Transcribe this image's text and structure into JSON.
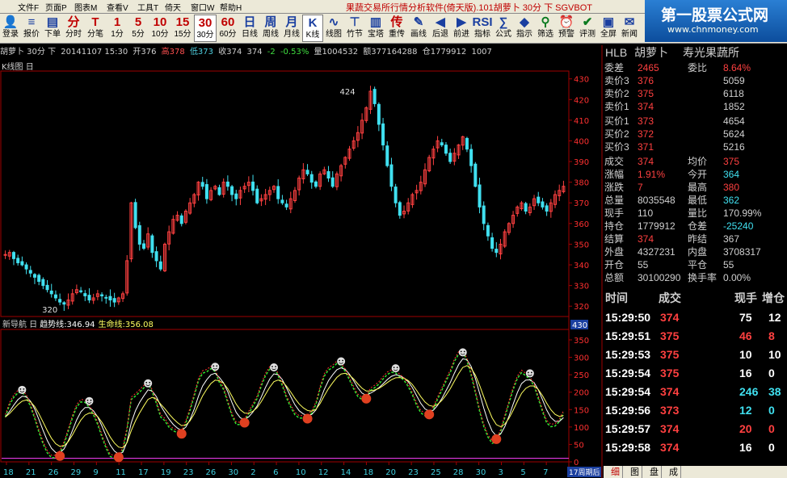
{
  "window": {
    "menus": [
      "文件F",
      "页面P",
      "图表M",
      "查看V",
      "工具T",
      "倚天",
      "窗口W",
      "帮助H"
    ],
    "title": "果蔬交易所行情分析软件(倚天版).101胡萝卜 30分 下 SGVBOT"
  },
  "brand": {
    "name": "第一股票公式网",
    "url": "www.chnmoney.com"
  },
  "toolbar": [
    {
      "icon": "👤",
      "label": "登录",
      "name": "login",
      "color": "blue"
    },
    {
      "icon": "≡",
      "label": "报价",
      "name": "quote",
      "color": "blue"
    },
    {
      "icon": "▤",
      "label": "下单",
      "name": "order",
      "color": "blue"
    },
    {
      "icon": "分",
      "label": "分时",
      "name": "intraday",
      "color": "red"
    },
    {
      "icon": "T",
      "label": "分笔",
      "name": "tick",
      "color": "red"
    },
    {
      "icon": "1",
      "label": "1分",
      "name": "1min",
      "color": "red"
    },
    {
      "icon": "5",
      "label": "5分",
      "name": "5min",
      "color": "red"
    },
    {
      "icon": "10",
      "label": "10分",
      "name": "10min",
      "color": "red"
    },
    {
      "icon": "15",
      "label": "15分",
      "name": "15min",
      "color": "red"
    },
    {
      "icon": "30",
      "label": "30分",
      "name": "30min",
      "color": "red",
      "selected": true
    },
    {
      "icon": "60",
      "label": "60分",
      "name": "60min",
      "color": "red"
    },
    {
      "icon": "日",
      "label": "日线",
      "name": "daily",
      "color": "blue"
    },
    {
      "icon": "周",
      "label": "周线",
      "name": "weekly",
      "color": "blue"
    },
    {
      "icon": "月",
      "label": "月线",
      "name": "monthly",
      "color": "blue"
    },
    {
      "icon": "K",
      "label": "K线",
      "name": "kline",
      "color": "blue",
      "selected": true
    },
    {
      "icon": "∿",
      "label": "线图",
      "name": "linechart",
      "color": "blue"
    },
    {
      "icon": "⊤",
      "label": "竹节",
      "name": "bamboo",
      "color": "blue"
    },
    {
      "icon": "▥",
      "label": "宝塔",
      "name": "tower",
      "color": "blue"
    },
    {
      "icon": "传",
      "label": "重传",
      "name": "resend",
      "color": "red"
    },
    {
      "icon": "✎",
      "label": "画线",
      "name": "draw",
      "color": "blue"
    },
    {
      "icon": "◀",
      "label": "后退",
      "name": "back",
      "color": "blue"
    },
    {
      "icon": "▶",
      "label": "前进",
      "name": "forward",
      "color": "blue"
    },
    {
      "icon": "RSI",
      "label": "指标",
      "name": "indicator",
      "color": "blue"
    },
    {
      "icon": "∑",
      "label": "公式",
      "name": "formula",
      "color": "blue"
    },
    {
      "icon": "◆",
      "label": "指示",
      "name": "hint",
      "color": "blue"
    },
    {
      "icon": "⚲",
      "label": "筛选",
      "name": "filter",
      "color": "green"
    },
    {
      "icon": "⏰",
      "label": "预警",
      "name": "alert",
      "color": "red"
    },
    {
      "icon": "✔",
      "label": "评测",
      "name": "evaluate",
      "color": "green"
    },
    {
      "icon": "▣",
      "label": "全屏",
      "name": "fullscreen",
      "color": "blue"
    },
    {
      "icon": "✉",
      "label": "新闻",
      "name": "news",
      "color": "blue"
    }
  ],
  "infobar": {
    "symbol": "胡萝卜 30分 下",
    "date": "20141107 15:30",
    "open": "开376",
    "high": "高378",
    "low": "低373",
    "close": "收374",
    "last": "374",
    "change": "-2",
    "pct": "-0.53%",
    "volume": "量1004532",
    "amount": "额377164288",
    "position": "仓1779912",
    "extra": "1007"
  },
  "kline_label": "K线图 日",
  "chart_data": [
    {
      "type": "candlestick",
      "title": "",
      "ylim": [
        315,
        433
      ],
      "yticks": [
        320,
        330,
        340,
        350,
        360,
        370,
        380,
        390,
        400,
        410,
        420,
        430
      ],
      "annotations": [
        {
          "text": "424",
          "value": 424
        },
        {
          "text": "320",
          "value": 320
        }
      ],
      "series": [
        {
          "values": [
            345,
            346,
            343,
            341,
            340,
            338,
            336,
            334,
            332,
            330,
            328,
            326,
            324,
            322,
            321,
            323,
            326,
            328,
            327,
            325,
            323,
            324,
            326,
            325,
            324,
            323,
            322,
            324,
            326,
            342,
            370,
            358,
            350,
            348,
            355,
            346,
            342,
            338,
            350,
            356,
            362,
            364,
            360,
            366,
            370,
            374,
            380,
            378,
            372,
            376,
            378,
            374,
            380,
            378,
            374,
            372,
            376,
            378,
            380,
            376,
            370,
            372,
            374,
            376,
            378,
            372,
            370,
            368,
            372,
            376,
            382,
            386,
            384,
            380,
            378,
            384,
            386,
            382,
            378,
            384,
            388,
            392,
            396,
            400,
            404,
            410,
            416,
            424,
            418,
            408,
            398,
            388,
            378,
            370,
            364,
            366,
            370,
            374,
            376,
            380,
            386,
            392,
            396,
            400,
            398,
            394,
            390,
            394,
            398,
            402,
            396,
            388,
            378,
            368,
            360,
            354,
            348,
            346,
            350,
            356,
            360,
            364,
            368,
            370,
            366,
            368,
            372,
            370,
            368,
            366,
            370,
            374,
            376,
            378
          ]
        }
      ]
    },
    {
      "type": "line",
      "title": "新导航 日",
      "series": [
        {
          "name": "趋势线",
          "last": "346.94",
          "color": "#ffffff"
        },
        {
          "name": "生命线",
          "last": "356.08",
          "color": "#ffff60"
        }
      ],
      "ylim": [
        0,
        380
      ],
      "yticks": [
        0,
        50,
        100,
        150,
        200,
        250,
        300,
        350
      ],
      "top_value": "430",
      "xticks": [
        "18",
        "21",
        "26",
        "29",
        "9",
        "11",
        "17",
        "19",
        "23",
        "26",
        "30",
        "2",
        "6",
        "10",
        "12",
        "14",
        "18",
        "20",
        "23",
        "25",
        "28",
        "30",
        "3",
        "5",
        "7"
      ],
      "footer": "17周期后"
    }
  ],
  "quote": {
    "code": "HLB",
    "name": "胡萝卜",
    "exchange": "寿光果蔬所",
    "weibi_label": "委差",
    "weibi": "2465",
    "weibi2_label": "委比",
    "weibi2": "8.64%",
    "asks": [
      {
        "label": "卖价3",
        "price": "376",
        "vol": "5059"
      },
      {
        "label": "卖价2",
        "price": "375",
        "vol": "6118"
      },
      {
        "label": "卖价1",
        "price": "374",
        "vol": "1852"
      }
    ],
    "bids": [
      {
        "label": "买价1",
        "price": "373",
        "vol": "4654"
      },
      {
        "label": "买价2",
        "price": "372",
        "vol": "5624"
      },
      {
        "label": "买价3",
        "price": "371",
        "vol": "5216"
      }
    ],
    "stats": [
      {
        "l1": "成交",
        "v1": "374",
        "c1": "r",
        "l2": "均价",
        "v2": "375",
        "c2": "r"
      },
      {
        "l1": "涨幅",
        "v1": "1.91%",
        "c1": "r",
        "l2": "今开",
        "v2": "364",
        "c2": "c"
      },
      {
        "l1": "涨跌",
        "v1": "7",
        "c1": "r",
        "l2": "最高",
        "v2": "380",
        "c2": "r"
      },
      {
        "l1": "总量",
        "v1": "8035548",
        "c1": "w",
        "l2": "最低",
        "v2": "362",
        "c2": "c"
      },
      {
        "l1": "现手",
        "v1": "110",
        "c1": "w",
        "l2": "量比",
        "v2": "170.99%",
        "c2": "w"
      },
      {
        "l1": "持仓",
        "v1": "1779912",
        "c1": "w",
        "l2": "仓差",
        "v2": "-25240",
        "c2": "c"
      },
      {
        "l1": "结算",
        "v1": "374",
        "c1": "r",
        "l2": "昨结",
        "v2": "367",
        "c2": "w"
      },
      {
        "l1": "外盘",
        "v1": "4327231",
        "c1": "w",
        "l2": "内盘",
        "v2": "3708317",
        "c2": "w"
      },
      {
        "l1": "开仓",
        "v1": "55",
        "c1": "w",
        "l2": "平仓",
        "v2": "55",
        "c2": "w"
      },
      {
        "l1": "总额",
        "v1": "30100290",
        "c1": "w",
        "l2": "换手率",
        "v2": "0.00%",
        "c2": "w"
      }
    ],
    "trades_header": {
      "time": "时间",
      "price": "成交",
      "vol": "现手",
      "oi": "增仓"
    },
    "trades": [
      {
        "time": "15:29:50",
        "price": "374",
        "vol": "75",
        "oi": "12",
        "pc": "r",
        "vc": "w"
      },
      {
        "time": "15:29:51",
        "price": "375",
        "vol": "46",
        "oi": "8",
        "pc": "r",
        "vc": "r"
      },
      {
        "time": "15:29:53",
        "price": "375",
        "vol": "10",
        "oi": "10",
        "pc": "r",
        "vc": "w"
      },
      {
        "time": "15:29:54",
        "price": "375",
        "vol": "16",
        "oi": "0",
        "pc": "r",
        "vc": "w"
      },
      {
        "time": "15:29:54",
        "price": "374",
        "vol": "246",
        "oi": "38",
        "pc": "r",
        "vc": "c"
      },
      {
        "time": "15:29:56",
        "price": "373",
        "vol": "12",
        "oi": "0",
        "pc": "r",
        "vc": "c"
      },
      {
        "time": "15:29:57",
        "price": "374",
        "vol": "20",
        "oi": "0",
        "pc": "r",
        "vc": "r"
      },
      {
        "time": "15:29:58",
        "price": "374",
        "vol": "16",
        "oi": "0",
        "pc": "r",
        "vc": "w"
      }
    ],
    "tabs": [
      "细",
      "图",
      "盘",
      "成"
    ]
  }
}
